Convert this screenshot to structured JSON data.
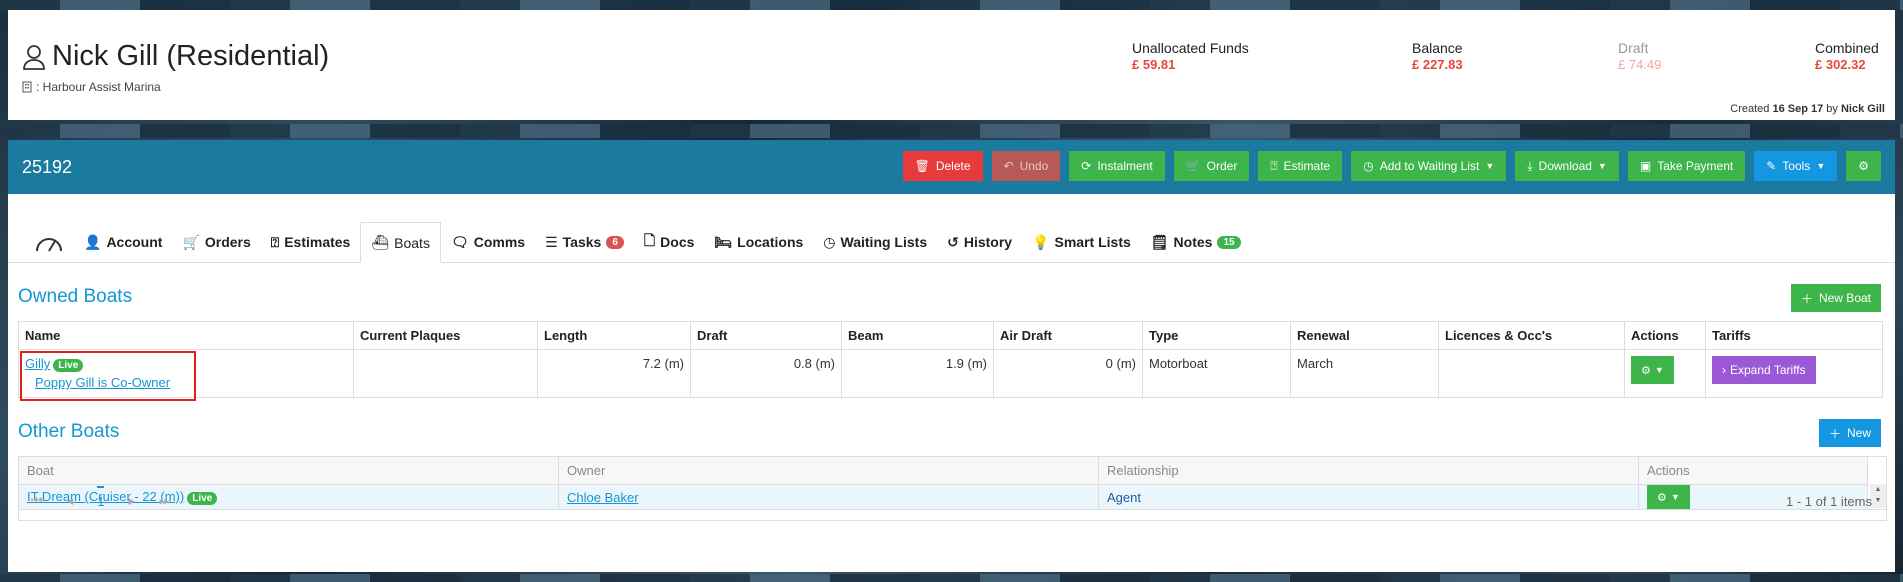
{
  "header": {
    "customer_name": "Nick Gill (Residential)",
    "site_label": ": Harbour Assist Marina",
    "funds": [
      {
        "label": "Unallocated Funds",
        "value": "£ 59.81"
      },
      {
        "label": "Balance",
        "value": "£ 227.83"
      },
      {
        "label": "Draft",
        "value": "£ 74.49"
      },
      {
        "label": "Combined",
        "value": "£ 302.32"
      }
    ],
    "created_prefix": "Created",
    "created_date": "16 Sep 17",
    "created_by_prefix": "by",
    "created_by": "Nick Gill"
  },
  "toolbar": {
    "account_number": "25192",
    "delete": "Delete",
    "undo": "Undo",
    "instalment": "Instalment",
    "order": "Order",
    "estimate": "Estimate",
    "waiting_list": "Add to Waiting List",
    "download": "Download",
    "take_payment": "Take Payment",
    "tools": "Tools"
  },
  "tabs": [
    {
      "label": ""
    },
    {
      "label": "Account"
    },
    {
      "label": "Orders"
    },
    {
      "label": "Estimates"
    },
    {
      "label": "Boats"
    },
    {
      "label": "Comms"
    },
    {
      "label": "Tasks",
      "count": "6"
    },
    {
      "label": "Docs"
    },
    {
      "label": "Locations"
    },
    {
      "label": "Waiting Lists"
    },
    {
      "label": "History"
    },
    {
      "label": "Smart Lists"
    },
    {
      "label": "Notes",
      "count": "15"
    }
  ],
  "owned": {
    "title": "Owned Boats",
    "new_button": "New Boat",
    "columns": [
      "Name",
      "Current Plaques",
      "Length",
      "Draft",
      "Beam",
      "Air Draft",
      "Type",
      "Renewal",
      "Licences & Occ's",
      "Actions",
      "Tariffs"
    ],
    "row": {
      "name": "Gilly",
      "status": "Live",
      "co_owner": "Poppy Gill is Co-Owner",
      "plaques": "",
      "length": "7.2 (m)",
      "draft": "0.8 (m)",
      "beam": "1.9 (m)",
      "air_draft": "0 (m)",
      "type": "Motorboat",
      "renewal": "March",
      "licences": "",
      "tariffs_button": "Expand Tariffs"
    }
  },
  "other": {
    "title": "Other Boats",
    "new_button": "New",
    "columns": [
      "Boat",
      "Owner",
      "Relationship",
      "Actions"
    ],
    "row": {
      "boat": "IT Dream (Cruiser - 22 (m))",
      "status": "Live",
      "owner": "Chloe Baker",
      "relationship": "Agent"
    },
    "pager": {
      "current_page": "1",
      "info": "1 - 1 of 1 items"
    }
  }
}
